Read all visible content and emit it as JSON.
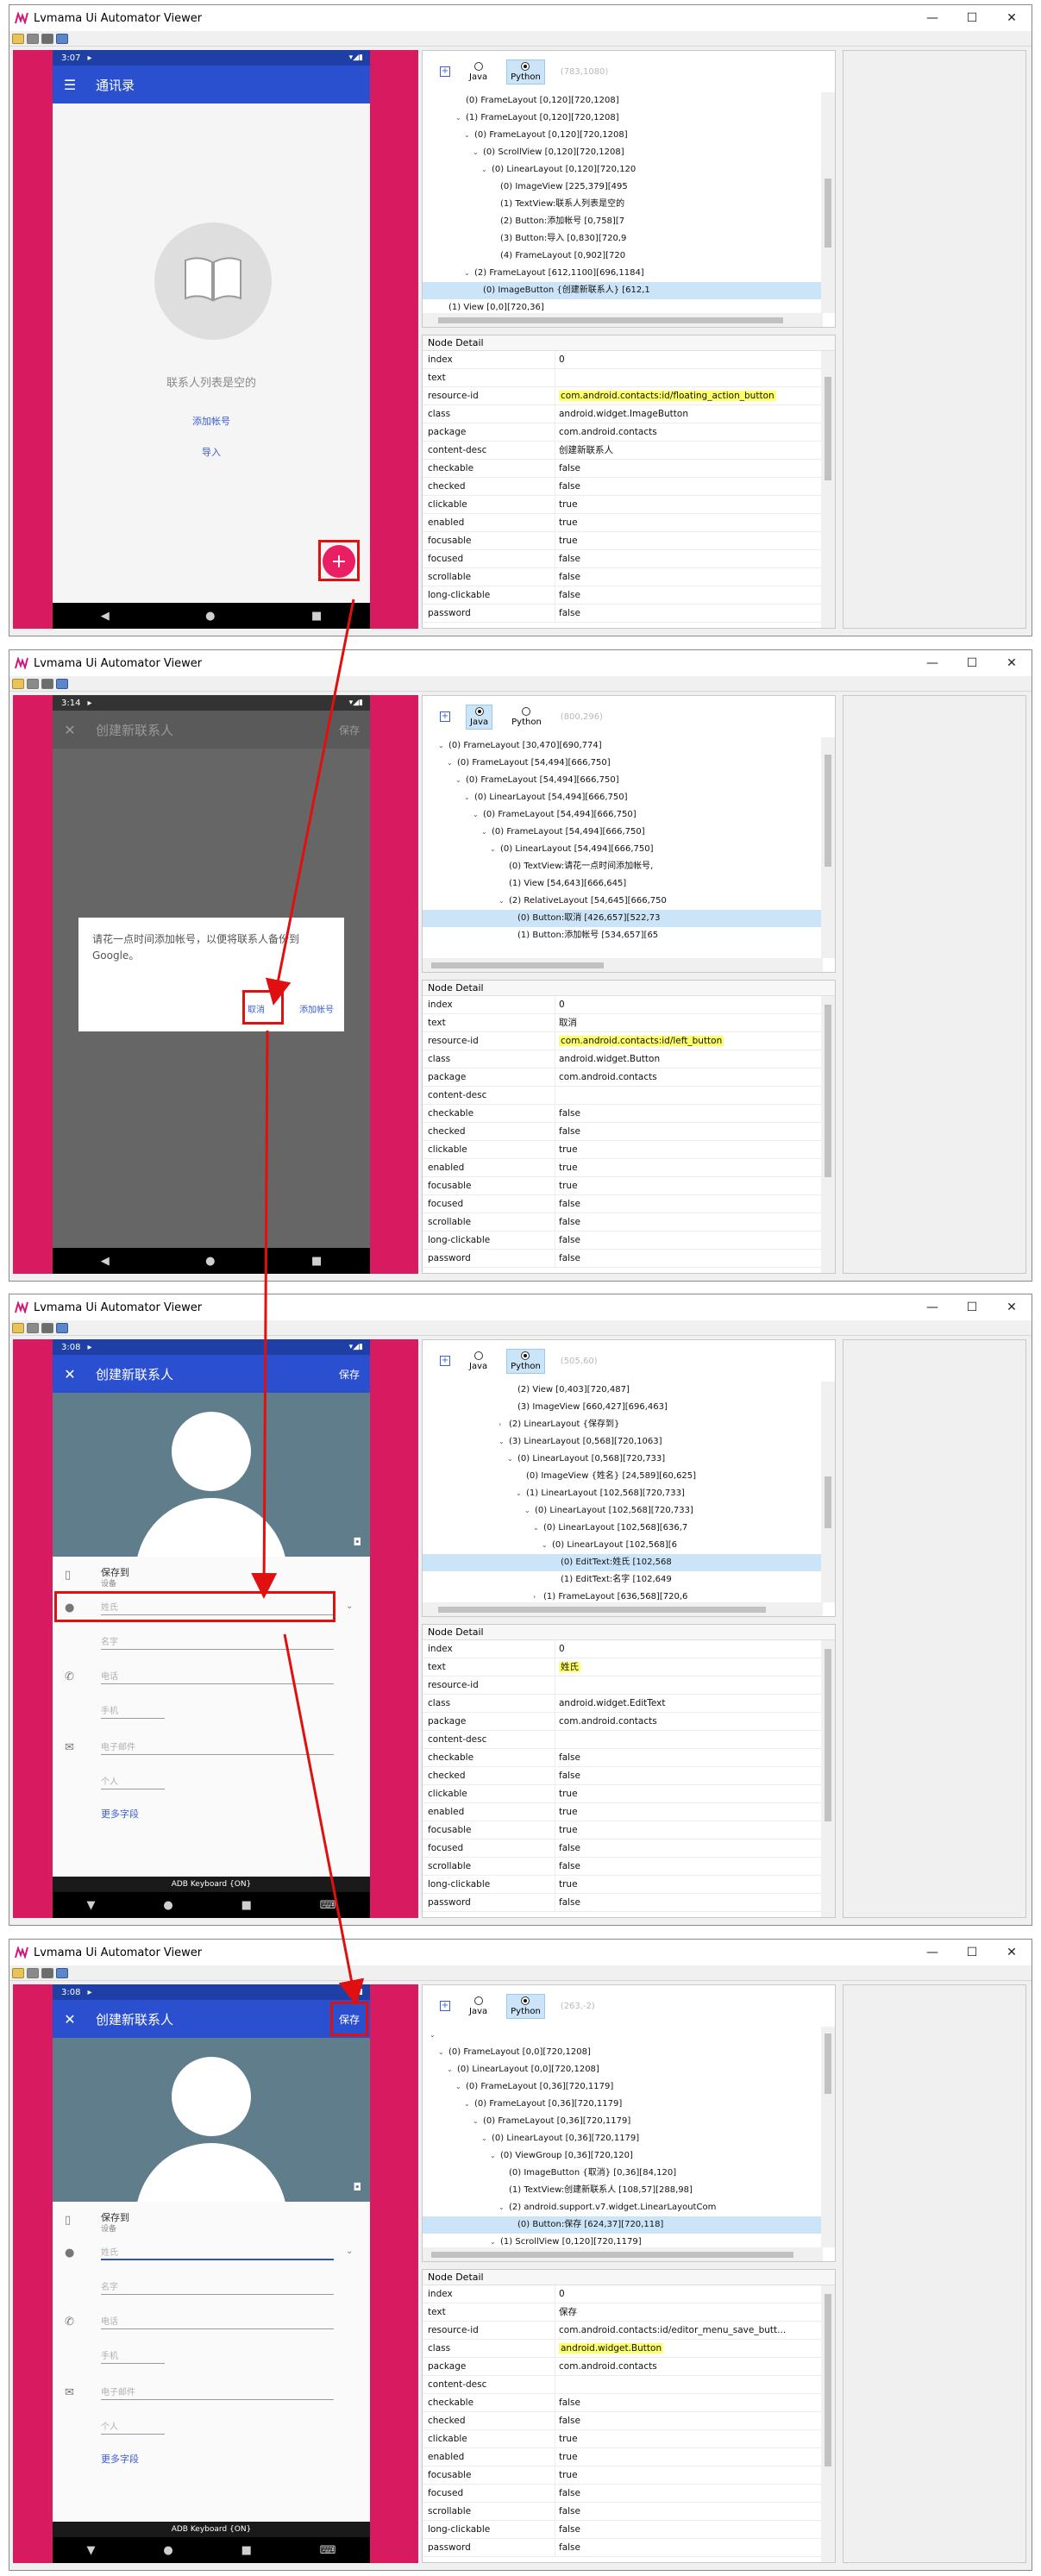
{
  "window": {
    "title": "Lvmama Ui Automator Viewer",
    "min": "—",
    "max": "☐",
    "close": "✕"
  },
  "common": {
    "nav_icons": [
      "◀",
      "●",
      "■"
    ],
    "node_detail_title": "Node Detail",
    "lang_java": "Java",
    "lang_python": "Python"
  },
  "screen1": {
    "status_time": "3:07",
    "status_icons": "▾◢▮",
    "app_title": "通讯录",
    "empty_text": "联系人列表是空的",
    "link_add_account": "添加帐号",
    "link_import": "导入",
    "fab": "+",
    "selected_lang": "python",
    "coords": "(783,1080)",
    "tree": [
      {
        "indent": 3,
        "arrow": "",
        "text": "(0) FrameLayout [0,120][720,1208]"
      },
      {
        "indent": 3,
        "arrow": "v",
        "text": "(1) FrameLayout [0,120][720,1208]"
      },
      {
        "indent": 4,
        "arrow": "v",
        "text": "(0) FrameLayout [0,120][720,1208]"
      },
      {
        "indent": 5,
        "arrow": "v",
        "text": "(0) ScrollView [0,120][720,1208]"
      },
      {
        "indent": 6,
        "arrow": "v",
        "text": "(0) LinearLayout [0,120][720,120"
      },
      {
        "indent": 7,
        "arrow": "",
        "text": "(0) ImageView [225,379][495"
      },
      {
        "indent": 7,
        "arrow": "",
        "text": "(1) TextView:联系人列表是空的"
      },
      {
        "indent": 7,
        "arrow": "",
        "text": "(2) Button:添加帐号 [0,758][7"
      },
      {
        "indent": 7,
        "arrow": "",
        "text": "(3) Button:导入 [0,830][720,9"
      },
      {
        "indent": 7,
        "arrow": "",
        "text": "(4) FrameLayout [0,902][720"
      },
      {
        "indent": 4,
        "arrow": "v",
        "text": "(2) FrameLayout [612,1100][696,1184]"
      },
      {
        "indent": 5,
        "arrow": "",
        "text": "(0) ImageButton {创建新联系人} [612,1",
        "selected": true
      },
      {
        "indent": 1,
        "arrow": "",
        "text": "(1) View [0,0][720,36]"
      }
    ],
    "details": [
      {
        "k": "index",
        "v": "0"
      },
      {
        "k": "text",
        "v": ""
      },
      {
        "k": "resource-id",
        "v": "com.android.contacts:id/floating_action_button",
        "hl": true
      },
      {
        "k": "class",
        "v": "android.widget.ImageButton"
      },
      {
        "k": "package",
        "v": "com.android.contacts"
      },
      {
        "k": "content-desc",
        "v": "创建新联系人"
      },
      {
        "k": "checkable",
        "v": "false"
      },
      {
        "k": "checked",
        "v": "false"
      },
      {
        "k": "clickable",
        "v": "true"
      },
      {
        "k": "enabled",
        "v": "true"
      },
      {
        "k": "focusable",
        "v": "true"
      },
      {
        "k": "focused",
        "v": "false"
      },
      {
        "k": "scrollable",
        "v": "false"
      },
      {
        "k": "long-clickable",
        "v": "false"
      },
      {
        "k": "password",
        "v": "false"
      }
    ]
  },
  "screen2": {
    "status_time": "3:14",
    "status_icons": "▾◢▮",
    "app_title": "创建新联系人",
    "app_action": "保存",
    "dialog_msg": "请花一点时间添加帐号，以便将联系人备份到Google。",
    "btn_cancel": "取消",
    "btn_add_account": "添加帐号",
    "selected_lang": "java",
    "coords": "(800,296)",
    "tree": [
      {
        "indent": 1,
        "arrow": "v",
        "text": "(0) FrameLayout [30,470][690,774]"
      },
      {
        "indent": 2,
        "arrow": "v",
        "text": "(0) FrameLayout [54,494][666,750]"
      },
      {
        "indent": 3,
        "arrow": "v",
        "text": "(0) FrameLayout [54,494][666,750]"
      },
      {
        "indent": 4,
        "arrow": "v",
        "text": "(0) LinearLayout [54,494][666,750]"
      },
      {
        "indent": 5,
        "arrow": "v",
        "text": "(0) FrameLayout [54,494][666,750]"
      },
      {
        "indent": 6,
        "arrow": "v",
        "text": "(0) FrameLayout [54,494][666,750]"
      },
      {
        "indent": 7,
        "arrow": "v",
        "text": "(0) LinearLayout [54,494][666,750]"
      },
      {
        "indent": 8,
        "arrow": "",
        "text": "(0) TextView:请花一点时间添加帐号,"
      },
      {
        "indent": 8,
        "arrow": "",
        "text": "(1) View [54,643][666,645]"
      },
      {
        "indent": 8,
        "arrow": "v",
        "text": "(2) RelativeLayout [54,645][666,750"
      },
      {
        "indent": 9,
        "arrow": "",
        "text": "(0) Button:取消 [426,657][522,73",
        "selected": true
      },
      {
        "indent": 9,
        "arrow": "",
        "text": "(1) Button:添加帐号 [534,657][65"
      }
    ],
    "details": [
      {
        "k": "index",
        "v": "0"
      },
      {
        "k": "text",
        "v": "取消"
      },
      {
        "k": "resource-id",
        "v": "com.android.contacts:id/left_button",
        "hl": true
      },
      {
        "k": "class",
        "v": "android.widget.Button"
      },
      {
        "k": "package",
        "v": "com.android.contacts"
      },
      {
        "k": "content-desc",
        "v": ""
      },
      {
        "k": "checkable",
        "v": "false"
      },
      {
        "k": "checked",
        "v": "false"
      },
      {
        "k": "clickable",
        "v": "true"
      },
      {
        "k": "enabled",
        "v": "true"
      },
      {
        "k": "focusable",
        "v": "true"
      },
      {
        "k": "focused",
        "v": "false"
      },
      {
        "k": "scrollable",
        "v": "false"
      },
      {
        "k": "long-clickable",
        "v": "false"
      },
      {
        "k": "password",
        "v": "false"
      }
    ]
  },
  "screen3": {
    "status_time": "3:08",
    "status_icons": "▾◢▮",
    "app_title": "创建新联系人",
    "app_action": "保存",
    "save_to": "保存到",
    "save_to_sub": "设备",
    "ph_last": "姓氏",
    "ph_first": "名字",
    "ph_phone": "电话",
    "sel_mobile": "手机",
    "ph_email": "电子邮件",
    "sel_personal": "个人",
    "more_fields": "更多字段",
    "keyboard": "ADB Keyboard {ON}",
    "camera": "◘",
    "selected_lang": "python",
    "coords": "(505,60)",
    "tree": [
      {
        "indent": 9,
        "arrow": "",
        "text": "(2) View [0,403][720,487]"
      },
      {
        "indent": 9,
        "arrow": "",
        "text": "(3) ImageView [660,427][696,463]"
      },
      {
        "indent": 8,
        "arrow": ">",
        "text": "(2) LinearLayout {保存到}"
      },
      {
        "indent": 8,
        "arrow": "v",
        "text": "(3) LinearLayout [0,568][720,1063]"
      },
      {
        "indent": 9,
        "arrow": "v",
        "text": "(0) LinearLayout [0,568][720,733]"
      },
      {
        "indent": 10,
        "arrow": "",
        "text": "(0) ImageView {姓名} [24,589][60,625]"
      },
      {
        "indent": 10,
        "arrow": "v",
        "text": "(1) LinearLayout [102,568][720,733]"
      },
      {
        "indent": 11,
        "arrow": "v",
        "text": "(0) LinearLayout [102,568][720,733]"
      },
      {
        "indent": 12,
        "arrow": "v",
        "text": "(0) LinearLayout [102,568][636,7"
      },
      {
        "indent": 13,
        "arrow": "v",
        "text": "(0) LinearLayout [102,568][6"
      },
      {
        "indent": 14,
        "arrow": "",
        "text": "(0) EditText:姓氏 [102,568",
        "selected": true
      },
      {
        "indent": 14,
        "arrow": "",
        "text": "(1) EditText:名字 [102,649"
      },
      {
        "indent": 12,
        "arrow": ">",
        "text": "(1) FrameLayout [636,568][720,6"
      }
    ],
    "details": [
      {
        "k": "index",
        "v": "0"
      },
      {
        "k": "text",
        "v": "姓氏",
        "hl": true
      },
      {
        "k": "resource-id",
        "v": ""
      },
      {
        "k": "class",
        "v": "android.widget.EditText"
      },
      {
        "k": "package",
        "v": "com.android.contacts"
      },
      {
        "k": "content-desc",
        "v": ""
      },
      {
        "k": "checkable",
        "v": "false"
      },
      {
        "k": "checked",
        "v": "false"
      },
      {
        "k": "clickable",
        "v": "true"
      },
      {
        "k": "enabled",
        "v": "true"
      },
      {
        "k": "focusable",
        "v": "true"
      },
      {
        "k": "focused",
        "v": "false"
      },
      {
        "k": "scrollable",
        "v": "false"
      },
      {
        "k": "long-clickable",
        "v": "true"
      },
      {
        "k": "password",
        "v": "false"
      }
    ]
  },
  "screen4": {
    "status_time": "3:08",
    "status_icons": "▾◢▮",
    "app_title": "创建新联系人",
    "app_action": "保存",
    "save_to": "保存到",
    "save_to_sub": "设备",
    "ph_last": "姓氏",
    "ph_first": "名字",
    "ph_phone": "电话",
    "sel_mobile": "手机",
    "ph_email": "电子邮件",
    "sel_personal": "个人",
    "more_fields": "更多字段",
    "keyboard": "ADB Keyboard {ON}",
    "camera": "◘",
    "selected_lang": "python",
    "coords": "(263,-2)",
    "tree": [
      {
        "indent": 0,
        "arrow": "v",
        "text": ""
      },
      {
        "indent": 1,
        "arrow": "v",
        "text": "(0) FrameLayout [0,0][720,1208]"
      },
      {
        "indent": 2,
        "arrow": "v",
        "text": "(0) LinearLayout [0,0][720,1208]"
      },
      {
        "indent": 3,
        "arrow": "v",
        "text": "(0) FrameLayout [0,36][720,1179]"
      },
      {
        "indent": 4,
        "arrow": "v",
        "text": "(0) FrameLayout [0,36][720,1179]"
      },
      {
        "indent": 5,
        "arrow": "v",
        "text": "(0) FrameLayout [0,36][720,1179]"
      },
      {
        "indent": 6,
        "arrow": "v",
        "text": "(0) LinearLayout [0,36][720,1179]"
      },
      {
        "indent": 7,
        "arrow": "v",
        "text": "(0) ViewGroup [0,36][720,120]"
      },
      {
        "indent": 8,
        "arrow": "",
        "text": "(0) ImageButton {取消} [0,36][84,120]"
      },
      {
        "indent": 8,
        "arrow": "",
        "text": "(1) TextView:创建新联系人 [108,57][288,98]"
      },
      {
        "indent": 8,
        "arrow": "v",
        "text": "(2) android.support.v7.widget.LinearLayoutCom"
      },
      {
        "indent": 9,
        "arrow": "",
        "text": "(0) Button:保存 [624,37][720,118]",
        "selected": true
      },
      {
        "indent": 7,
        "arrow": "v",
        "text": "(1) ScrollView [0,120][720,1179]"
      }
    ],
    "details": [
      {
        "k": "index",
        "v": "0"
      },
      {
        "k": "text",
        "v": "保存"
      },
      {
        "k": "resource-id",
        "v": "com.android.contacts:id/editor_menu_save_butt..."
      },
      {
        "k": "class",
        "v": "android.widget.Button",
        "hl": true
      },
      {
        "k": "package",
        "v": "com.android.contacts"
      },
      {
        "k": "content-desc",
        "v": ""
      },
      {
        "k": "checkable",
        "v": "false"
      },
      {
        "k": "checked",
        "v": "false"
      },
      {
        "k": "clickable",
        "v": "true"
      },
      {
        "k": "enabled",
        "v": "true"
      },
      {
        "k": "focusable",
        "v": "true"
      },
      {
        "k": "focused",
        "v": "false"
      },
      {
        "k": "scrollable",
        "v": "false"
      },
      {
        "k": "long-clickable",
        "v": "false"
      },
      {
        "k": "password",
        "v": "false"
      }
    ]
  }
}
